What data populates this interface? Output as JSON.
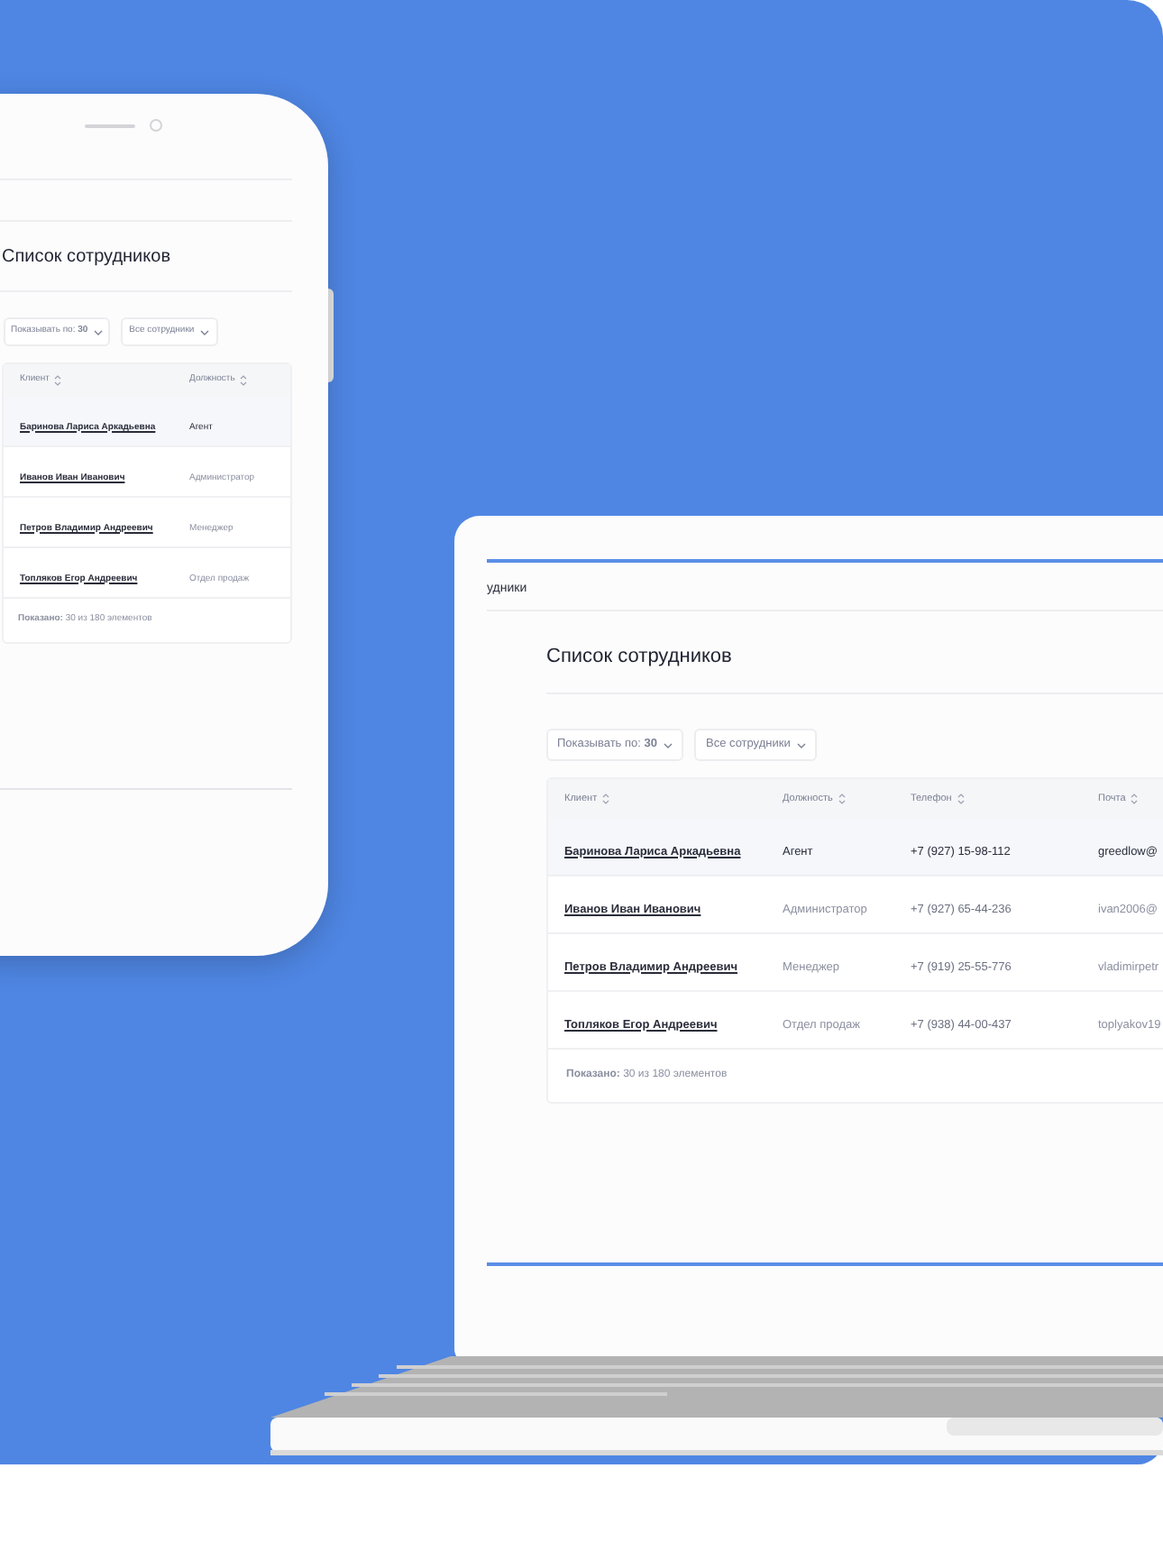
{
  "phone": {
    "title": "Список сотрудников",
    "page_size": "Показывать по: **30**",
    "filter": "Все сотрудники",
    "columns": [
      "Клиент",
      "Должность"
    ],
    "rows": [
      {
        "name": "Баринова Лариса Аркадьевна",
        "role": "Агент",
        "selected": true
      },
      {
        "name": "Иванов Иван Иванович",
        "role": "Администратор",
        "selected": false
      },
      {
        "name": "Петров Владимир Андреевич",
        "role": "Менеджер",
        "selected": false
      },
      {
        "name": "Топляков Егор Андреевич",
        "role": "Отдел продаж",
        "selected": false
      }
    ],
    "footer": "**Показано:** 30 из 180 элементов"
  },
  "laptop": {
    "breadcrumb": "удники",
    "title": "Список сотрудников",
    "page_size": "Показывать по: **30**",
    "filter": "Все сотрудники",
    "columns": [
      "Клиент",
      "Должность",
      "Телефон",
      "Почта"
    ],
    "rows": [
      {
        "name": "Баринова Лариса Аркадьевна",
        "role": "Агент",
        "phone": "+7 (927) 15-98-112",
        "email": "greedlow@",
        "selected": true
      },
      {
        "name": "Иванов Иван Иванович",
        "role": "Администратор",
        "phone": "+7 (927) 65-44-236",
        "email": "ivan2006@",
        "selected": false
      },
      {
        "name": "Петров Владимир Андреевич",
        "role": "Менеджер",
        "phone": "+7 (919) 25-55-776",
        "email": "vladimirpetr",
        "selected": false
      },
      {
        "name": "Топляков Егор Андреевич",
        "role": "Отдел продаж",
        "phone": "+7 (938) 44-00-437",
        "email": "toplyakov19",
        "selected": false
      }
    ],
    "footer": "**Показано:** 30 из 180 элементов"
  }
}
